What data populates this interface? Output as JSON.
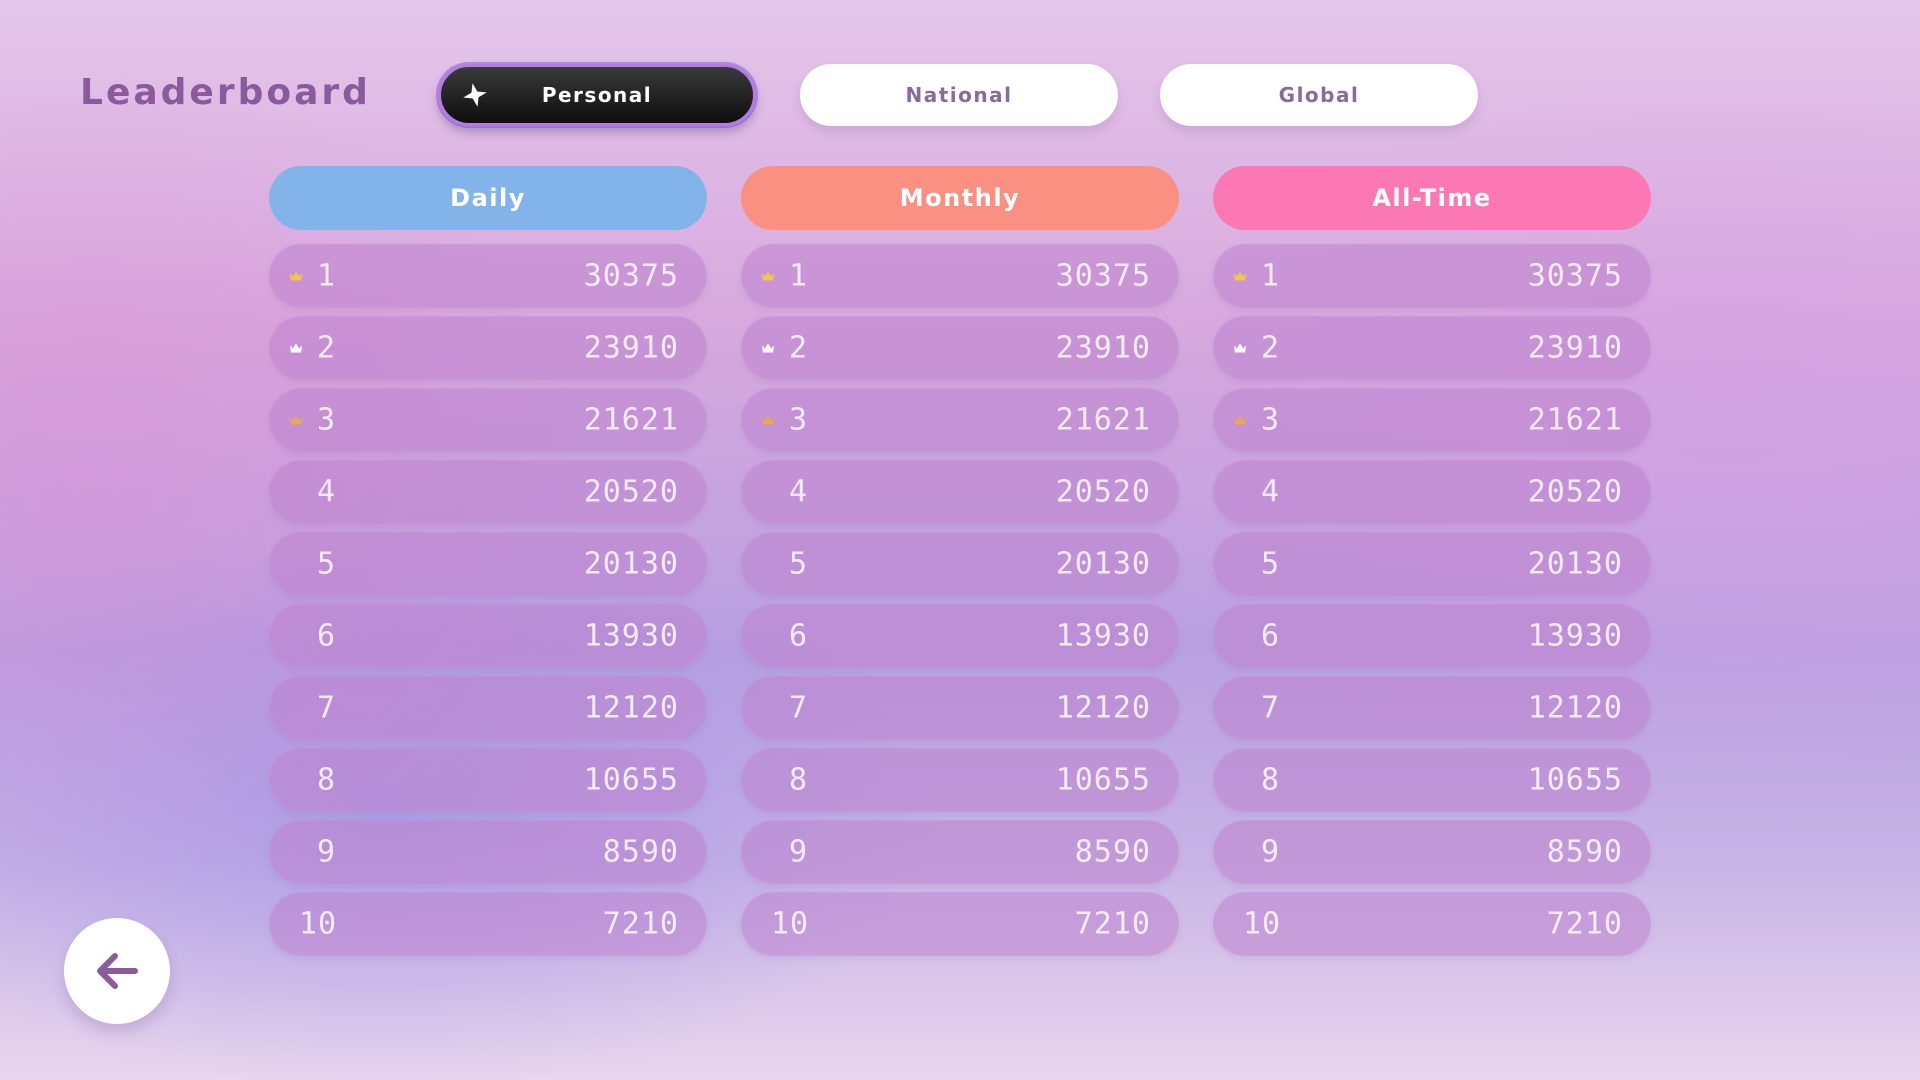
{
  "title": "Leaderboard",
  "tabs": [
    {
      "label": "Personal",
      "active": true,
      "icon": "sparkle-icon"
    },
    {
      "label": "National",
      "active": false
    },
    {
      "label": "Global",
      "active": false
    }
  ],
  "columns": [
    {
      "label": "Daily",
      "color": "#82b4ea"
    },
    {
      "label": "Monthly",
      "color": "#fa9082"
    },
    {
      "label": "All-Time",
      "color": "#fb78b4"
    }
  ],
  "entries": [
    {
      "rank": "1",
      "score": "30375",
      "crown": "gold"
    },
    {
      "rank": "2",
      "score": "23910",
      "crown": "silver"
    },
    {
      "rank": "3",
      "score": "21621",
      "crown": "bronze"
    },
    {
      "rank": "4",
      "score": "20520",
      "crown": null
    },
    {
      "rank": "5",
      "score": "20130",
      "crown": null
    },
    {
      "rank": "6",
      "score": "13930",
      "crown": null
    },
    {
      "rank": "7",
      "score": "12120",
      "crown": null
    },
    {
      "rank": "8",
      "score": "10655",
      "crown": null
    },
    {
      "rank": "9",
      "score": "8590",
      "crown": null
    },
    {
      "rank": "10",
      "score": "7210",
      "crown": null
    }
  ],
  "crown_colors": {
    "gold": "#f3c64a",
    "silver": "#ffffff",
    "bronze": "#e8a85a"
  },
  "back_button": {
    "icon": "arrow-left-icon",
    "color": "#8a5a9c"
  }
}
